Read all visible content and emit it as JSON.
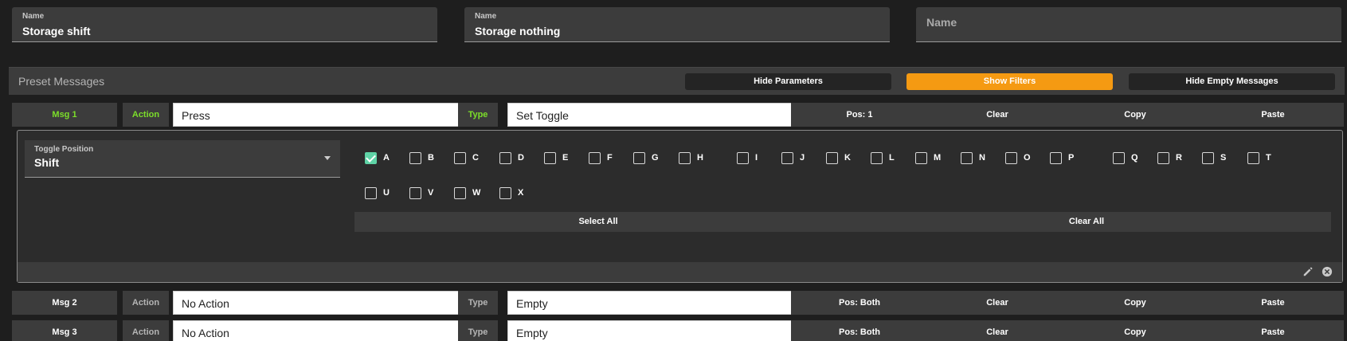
{
  "names": [
    {
      "label": "Name",
      "value": "Storage shift"
    },
    {
      "label": "Name",
      "value": "Storage nothing"
    },
    {
      "placeholder": "Name"
    }
  ],
  "preset": {
    "title": "Preset Messages",
    "hide_parameters": "Hide Parameters",
    "show_filters": "Show Filters",
    "hide_empty": "Hide Empty Messages"
  },
  "messages": [
    {
      "label": "Msg 1",
      "action_tag": "Action",
      "action": "Press",
      "type_tag": "Type",
      "type": "Set Toggle",
      "pos": "Pos: 1",
      "clear": "Clear",
      "copy": "Copy",
      "paste": "Paste"
    },
    {
      "label": "Msg 2",
      "action_tag": "Action",
      "action": "No Action",
      "type_tag": "Type",
      "type": "Empty",
      "pos": "Pos: Both",
      "clear": "Clear",
      "copy": "Copy",
      "paste": "Paste"
    },
    {
      "label": "Msg 3",
      "action_tag": "Action",
      "action": "No Action",
      "type_tag": "Type",
      "type": "Empty",
      "pos": "Pos: Both",
      "clear": "Clear",
      "copy": "Copy",
      "paste": "Paste"
    }
  ],
  "toggle": {
    "label": "Toggle Position",
    "value": "Shift",
    "checkboxes": [
      {
        "letter": "A",
        "checked": true
      },
      {
        "letter": "B",
        "checked": false
      },
      {
        "letter": "C",
        "checked": false
      },
      {
        "letter": "D",
        "checked": false
      },
      {
        "letter": "E",
        "checked": false
      },
      {
        "letter": "F",
        "checked": false
      },
      {
        "letter": "G",
        "checked": false
      },
      {
        "letter": "H",
        "checked": false
      },
      {
        "letter": "I",
        "checked": false
      },
      {
        "letter": "J",
        "checked": false
      },
      {
        "letter": "K",
        "checked": false
      },
      {
        "letter": "L",
        "checked": false
      },
      {
        "letter": "M",
        "checked": false
      },
      {
        "letter": "N",
        "checked": false
      },
      {
        "letter": "O",
        "checked": false
      },
      {
        "letter": "P",
        "checked": false
      },
      {
        "letter": "Q",
        "checked": false
      },
      {
        "letter": "R",
        "checked": false
      },
      {
        "letter": "S",
        "checked": false
      },
      {
        "letter": "T",
        "checked": false
      },
      {
        "letter": "U",
        "checked": false
      },
      {
        "letter": "V",
        "checked": false
      },
      {
        "letter": "W",
        "checked": false
      },
      {
        "letter": "X",
        "checked": false
      }
    ],
    "select_all": "Select All",
    "clear_all": "Clear All"
  },
  "colors": {
    "accent": "#f59a12",
    "green": "#7cde2a",
    "check": "#5fd3a6"
  },
  "icons": [
    "pencil-icon",
    "close-circle-icon",
    "caret-down-icon",
    "checkmark-icon"
  ]
}
